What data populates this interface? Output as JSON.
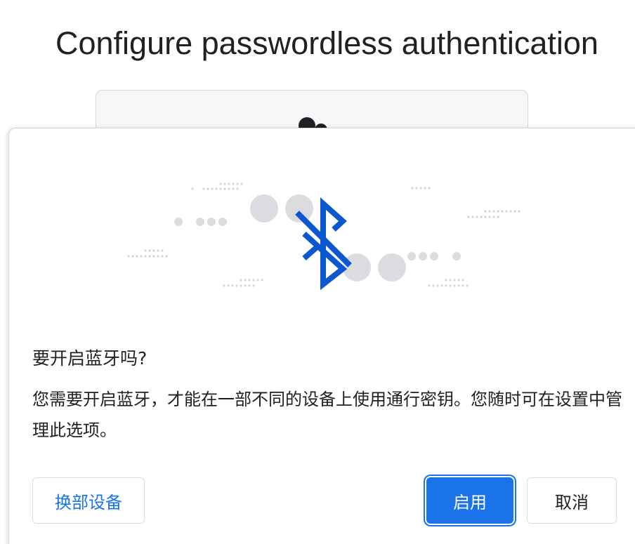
{
  "page": {
    "title": "Configure passwordless authentication"
  },
  "dialog": {
    "title": "要开启蓝牙吗?",
    "body": "您需要开启蓝牙，才能在一部不同的设备上使用通行密钥。您随时可在设置中管理此选项。",
    "illustration_icon": "bluetooth-disabled-icon"
  },
  "buttons": {
    "switch_device": "换部设备",
    "enable": "启用",
    "cancel": "取消"
  },
  "colors": {
    "accent": "#1a73e8",
    "bluetooth_icon": "#0b57d0",
    "dots": "#dadce0"
  }
}
